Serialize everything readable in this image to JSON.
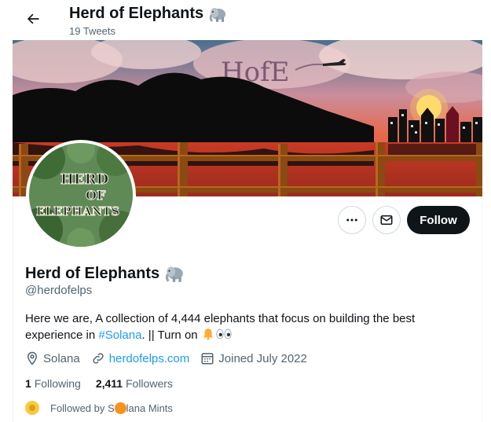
{
  "header": {
    "title": "Herd of Elephants",
    "title_emoji": "elephant-emoji",
    "tweet_count": "19 Tweets"
  },
  "banner": {
    "logo_text": "HofE"
  },
  "avatar": {
    "line1": "HERD",
    "line2": "OF",
    "line3": "ELEPHANTS"
  },
  "actions": {
    "more_icon": "more-icon",
    "message_icon": "envelope-icon",
    "follow_label": "Follow"
  },
  "profile": {
    "name": "Herd of Elephants",
    "handle": "@herdofelps",
    "bio_before": "Here we are, A collection of 4,444 elephants that focus on building the best experience in ",
    "bio_tag": "#Solana",
    "bio_after": ". || Turn on ",
    "location": "Solana",
    "website": "herdofelps.com",
    "joined": "Joined July 2022"
  },
  "counts": {
    "following_number": "1",
    "following_label": "Following",
    "followers_number": "2,411",
    "followers_label": "Followers"
  },
  "followed_by": {
    "prefix": "Followed by S",
    "suffix": "lana Mints"
  },
  "colors": {
    "accent": "#1d9bf0",
    "text": "#0f1419",
    "secondary": "#536471",
    "follow_bg": "#0f1419"
  }
}
